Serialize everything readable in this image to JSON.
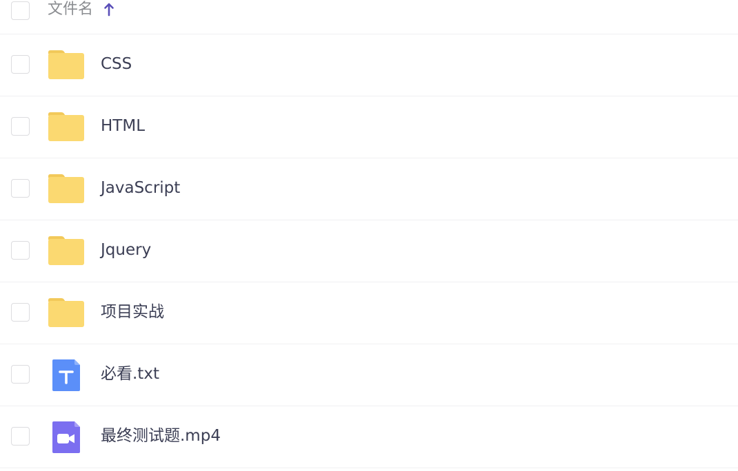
{
  "header": {
    "column_label": "文件名",
    "sort_icon": "arrow-up-icon",
    "sort_direction": "ascending",
    "accent_color": "#5a4fb8"
  },
  "files": [
    {
      "name": "CSS",
      "type": "folder",
      "icon": "folder-icon"
    },
    {
      "name": "HTML",
      "type": "folder",
      "icon": "folder-icon"
    },
    {
      "name": "JavaScript",
      "type": "folder",
      "icon": "folder-icon"
    },
    {
      "name": "Jquery",
      "type": "folder",
      "icon": "folder-icon"
    },
    {
      "name": "项目实战",
      "type": "folder",
      "icon": "folder-icon"
    },
    {
      "name": "必看.txt",
      "type": "text",
      "icon": "text-file-icon"
    },
    {
      "name": "最终测试题.mp4",
      "type": "video",
      "icon": "video-file-icon"
    }
  ],
  "colors": {
    "folder": "#fbd971",
    "folder_tab": "#f2c95a",
    "text_file": "#5b8ff9",
    "video_file": "#7b6ef0",
    "text": "#3b3e54",
    "muted": "#8a8c90",
    "border": "#dcdcdf"
  }
}
